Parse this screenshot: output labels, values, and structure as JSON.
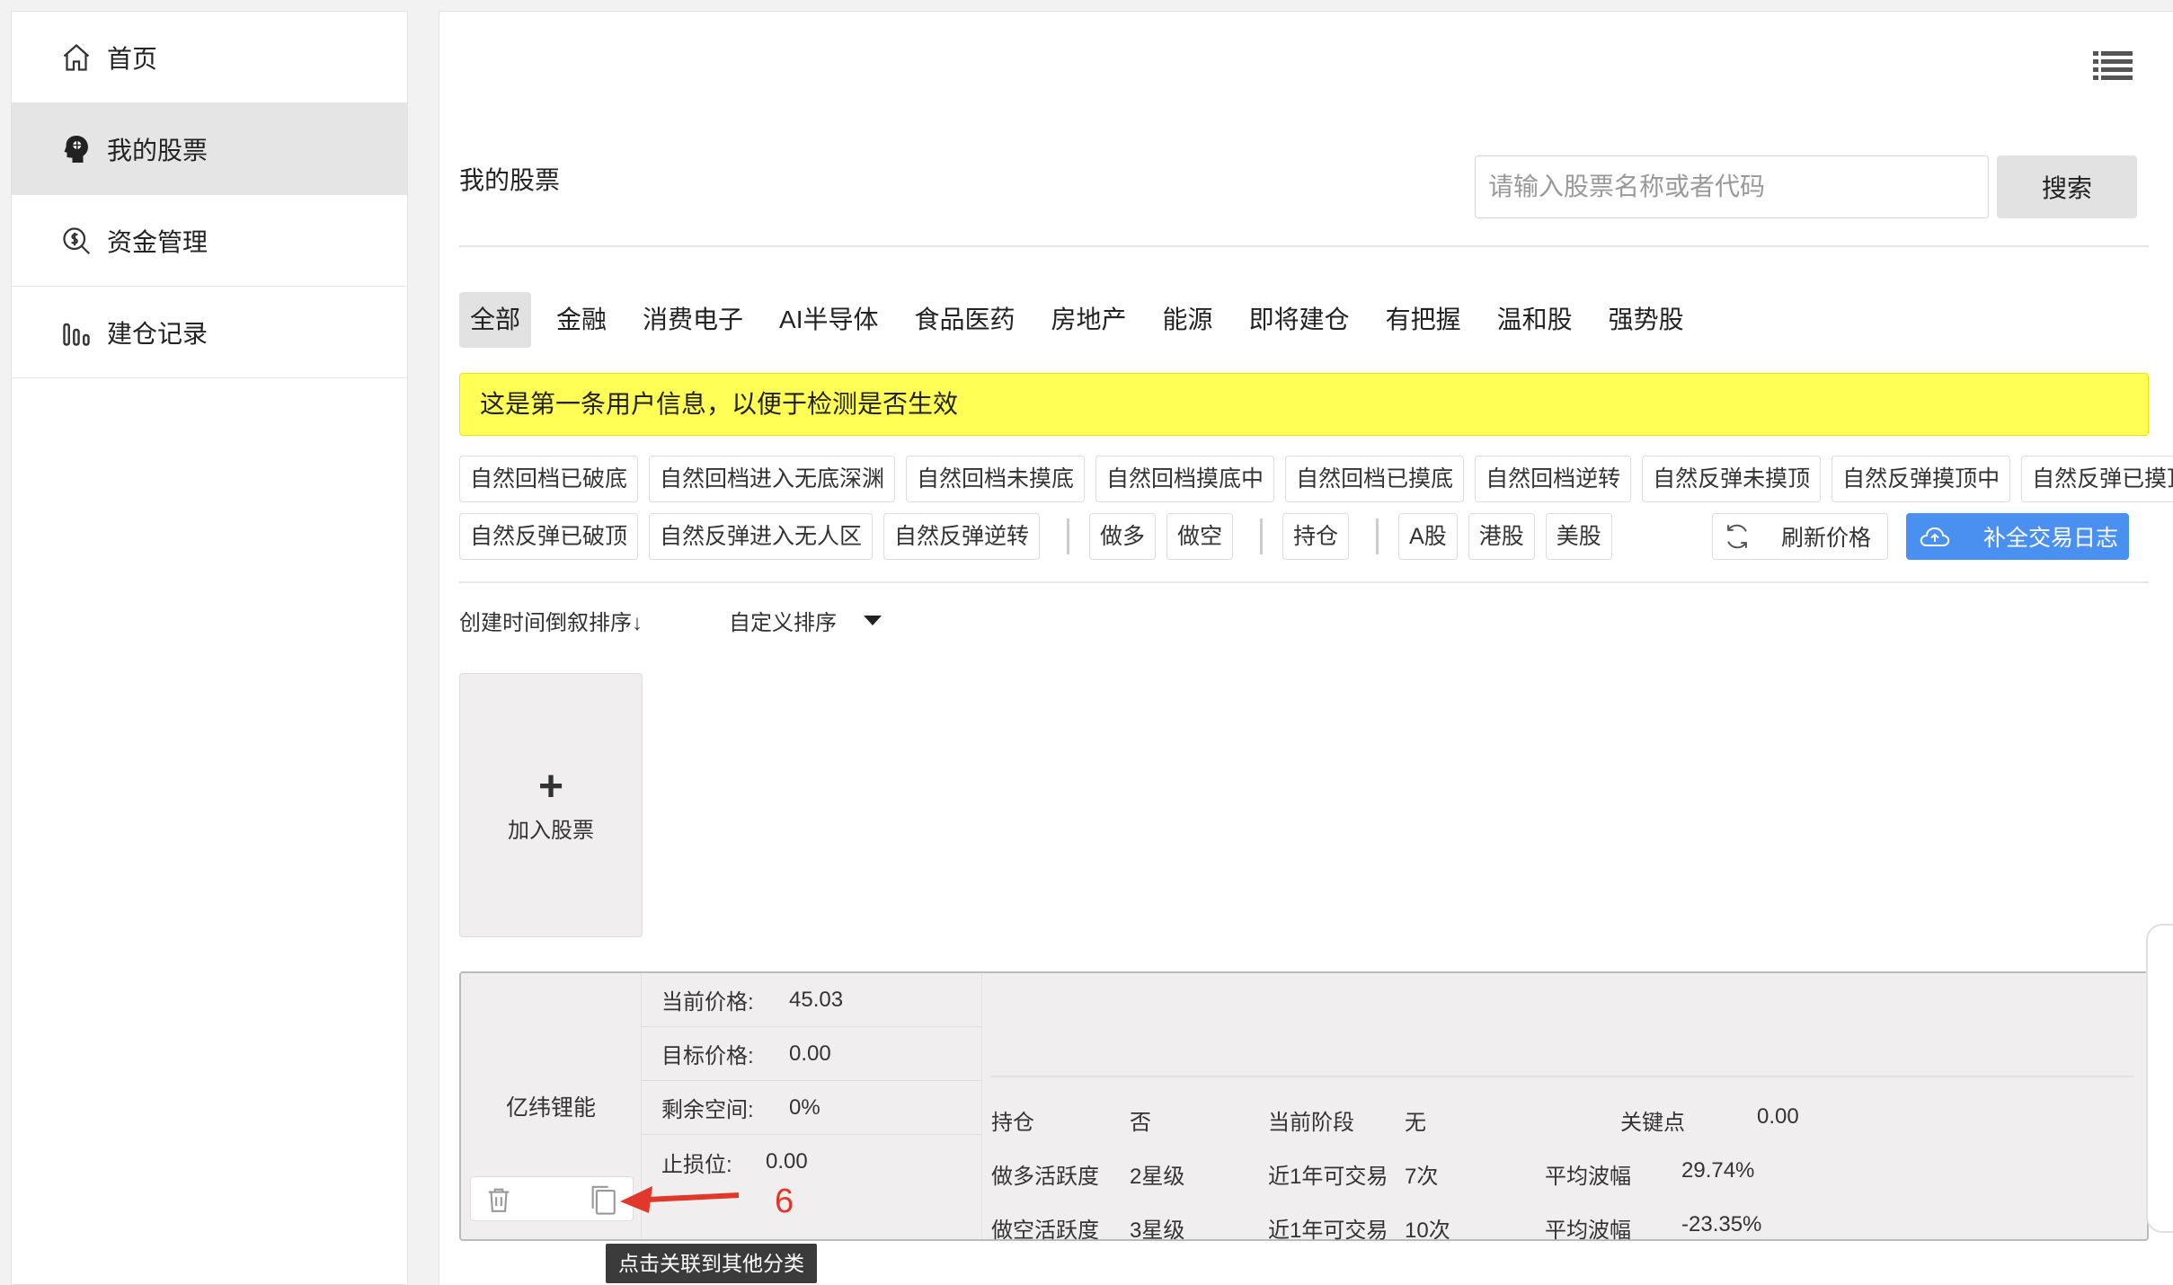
{
  "sidebar": {
    "items": [
      {
        "label": "首页",
        "icon": "home-icon"
      },
      {
        "label": "我的股票",
        "icon": "brain-head-icon"
      },
      {
        "label": "资金管理",
        "icon": "money-search-icon"
      },
      {
        "label": "建仓记录",
        "icon": "bar-chart-icon"
      }
    ],
    "active_index": 1
  },
  "header": {
    "title": "我的股票",
    "search": {
      "placeholder": "请输入股票名称或者代码",
      "value": "",
      "button": "搜索"
    }
  },
  "categories": [
    "全部",
    "金融",
    "消费电子",
    "AI半导体",
    "食品医药",
    "房地产",
    "能源",
    "即将建仓",
    "有把握",
    "温和股",
    "强势股"
  ],
  "active_category": "全部",
  "notice": "这是第一条用户信息，以便于检测是否生效",
  "tags_row1": [
    "自然回档已破底",
    "自然回档进入无底深渊",
    "自然回档未摸底",
    "自然回档摸底中",
    "自然回档已摸底",
    "自然回档逆转",
    "自然反弹未摸顶",
    "自然反弹摸顶中",
    "自然反弹已摸顶"
  ],
  "tags_row2_a": [
    "自然反弹已破顶",
    "自然反弹进入无人区",
    "自然反弹逆转"
  ],
  "tags_row2_b": [
    "做多",
    "做空"
  ],
  "tags_row2_c": [
    "持仓"
  ],
  "tags_row2_d": [
    "A股",
    "港股",
    "美股"
  ],
  "buttons": {
    "refresh": "刷新价格",
    "fill_log": "补全交易日志"
  },
  "sort": {
    "time": "创建时间倒叙排序↓",
    "custom": "自定义排序"
  },
  "add_card": {
    "plus": "+",
    "label": "加入股票"
  },
  "stock": {
    "name": "亿纬锂能",
    "current_price_label": "当前价格:",
    "current_price": "45.03",
    "target_price_label": "目标价格:",
    "target_price": "0.00",
    "remaining_label": "剩余空间:",
    "remaining": "0%",
    "stop_loss_label": "止损位:",
    "stop_loss": "0.00",
    "row1": {
      "hold_label": "持仓",
      "hold": "否",
      "stage_label": "当前阶段",
      "stage": "无",
      "key_label": "关键点",
      "key": "0.00"
    },
    "row2": {
      "long_label": "做多活跃度",
      "long": "2星级",
      "trade_label": "近1年可交易",
      "trade": "7次",
      "amp_label": "平均波幅",
      "amp": "29.74%"
    },
    "row3": {
      "short_label": "做空活跃度",
      "short": "3星级",
      "trade_label": "近1年可交易",
      "trade": "10次",
      "amp_label": "平均波幅",
      "amp": "-23.35%"
    }
  },
  "annotation": {
    "number": "6",
    "tooltip": "点击关联到其他分类"
  },
  "colors": {
    "notice_bg": "#ffff55",
    "primary_button": "#4a90f0",
    "annotation": "#e0392b"
  }
}
